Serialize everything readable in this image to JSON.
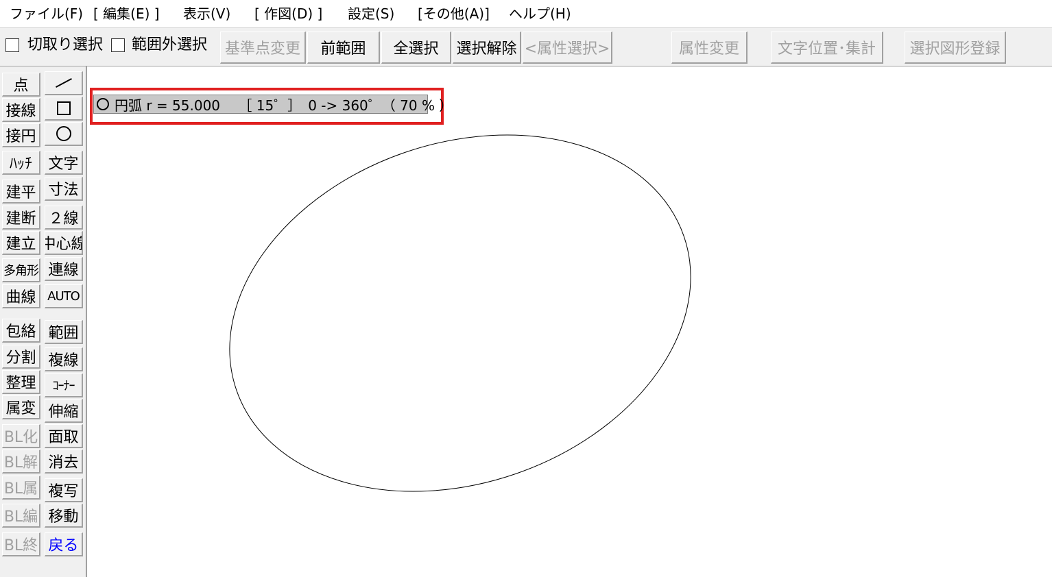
{
  "menu": [
    {
      "id": "file",
      "label": "ファイル(F)"
    },
    {
      "id": "edit",
      "label": "[ 編集(E) ]"
    },
    {
      "id": "view",
      "label": "表示(V)"
    },
    {
      "id": "draw",
      "label": "[ 作図(D) ]"
    },
    {
      "id": "settings",
      "label": "設定(S)"
    },
    {
      "id": "other",
      "label": "[その他(A)]"
    },
    {
      "id": "help",
      "label": "ヘルプ(H)"
    }
  ],
  "toolbar": {
    "checkboxes": [
      {
        "label": "切取り選択",
        "checked": false
      },
      {
        "label": "範囲外選択",
        "checked": false
      }
    ],
    "buttons": [
      {
        "label": "基準点変更",
        "enabled": false
      },
      {
        "label": "前範囲",
        "enabled": true
      },
      {
        "label": "全選択",
        "enabled": true
      },
      {
        "label": "選択解除",
        "enabled": true
      },
      {
        "label": "<属性選択>",
        "enabled": false
      },
      {
        "label": "属性変更",
        "enabled": false
      },
      {
        "label": "文字位置･集計",
        "enabled": false
      },
      {
        "label": "選択図形登録",
        "enabled": false
      }
    ]
  },
  "palette": {
    "left": [
      {
        "label": "点"
      },
      {
        "label": "接線"
      },
      {
        "label": "接円"
      },
      {
        "label": "ﾊｯﾁ"
      },
      {
        "label": "建平"
      },
      {
        "label": "建断"
      },
      {
        "label": "建立"
      },
      {
        "label": "多角形"
      },
      {
        "label": "曲線"
      },
      {
        "label": "包絡"
      },
      {
        "label": "分割"
      },
      {
        "label": "整理"
      },
      {
        "label": "属変"
      },
      {
        "label": "BL化",
        "disabled": true
      },
      {
        "label": "BL解",
        "disabled": true
      },
      {
        "label": "BL属",
        "disabled": true
      },
      {
        "label": "BL編",
        "disabled": true
      },
      {
        "label": "BL終",
        "disabled": true
      }
    ],
    "right": [
      {
        "icon": "line-icon"
      },
      {
        "icon": "rectangle-icon"
      },
      {
        "icon": "circle-icon"
      },
      {
        "label": "文字"
      },
      {
        "label": "寸法"
      },
      {
        "label": "２線"
      },
      {
        "label": "中心線"
      },
      {
        "label": "連線"
      },
      {
        "label": "AUTO"
      },
      {
        "label": "範囲"
      },
      {
        "label": "複線"
      },
      {
        "label": "ｺｰﾅｰ"
      },
      {
        "label": "伸縮"
      },
      {
        "label": "面取"
      },
      {
        "label": "消去"
      },
      {
        "label": "複写"
      },
      {
        "label": "移動"
      },
      {
        "label": "戻る",
        "color": "#0000ff"
      }
    ]
  },
  "status": {
    "icon": "circle-icon",
    "text": "円弧 r = 55.000　 ［ 15゜］　0 -> 360゜（ 70 % ）"
  },
  "colors": {
    "highlight": "#e02020",
    "undo_label": "#0000ff",
    "disabled_text": "#a0a0a0"
  }
}
